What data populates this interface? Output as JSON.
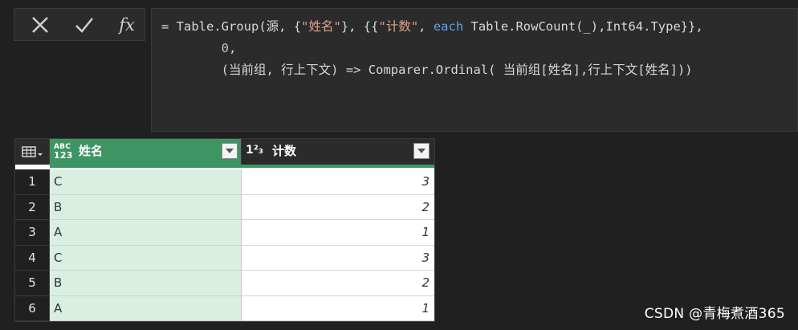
{
  "formula_bar": {
    "cancel_icon": "close-icon",
    "commit_icon": "check-icon",
    "fx_label": "fx",
    "line1_a": "= Table.Group(源, {",
    "line1_s1": "\"姓名\"",
    "line1_b": "}, {{",
    "line1_s2": "\"计数\"",
    "line1_c": ", ",
    "line1_kw": "each",
    "line1_d": " Table.RowCount(_),Int64.Type}},",
    "line2": "0",
    "line2_tail": ",",
    "line3": "(当前组, 行上下文) => Comparer.Ordinal( 当前组[姓名],行上下文[姓名]))"
  },
  "table": {
    "corner_icon": "table-menu-icon",
    "columns": [
      {
        "type_label_top": "ABC",
        "type_label_bottom": "123",
        "title": "姓名"
      },
      {
        "type_label": "1²₃",
        "title": "计数"
      }
    ],
    "rows": [
      {
        "n": "1",
        "name": "C",
        "count": "3"
      },
      {
        "n": "2",
        "name": "B",
        "count": "2"
      },
      {
        "n": "3",
        "name": "A",
        "count": "1"
      },
      {
        "n": "4",
        "name": "C",
        "count": "3"
      },
      {
        "n": "5",
        "name": "B",
        "count": "2"
      },
      {
        "n": "6",
        "name": "A",
        "count": "1"
      }
    ]
  },
  "watermark": "CSDN @青梅煮酒365",
  "colors": {
    "selected_column": "#3f9464",
    "selected_cell": "#d8efe1"
  }
}
